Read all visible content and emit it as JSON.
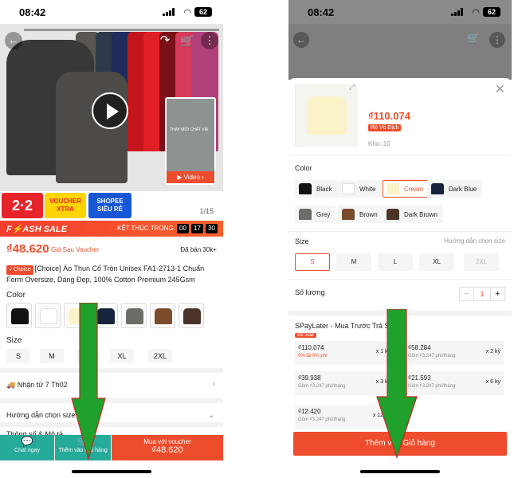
{
  "colors": {
    "accent": "#ee4d2d",
    "teal": "#26aa99",
    "arrow": "#1fa12b"
  },
  "left": {
    "status": {
      "time": "08:42",
      "battery": "62"
    },
    "hero": {
      "video_label": "▶ Video ›",
      "image_counter": "1/15",
      "thumb_caption": "THAY MỚI CHẤT VẢI"
    },
    "promo": {
      "p22": "2·2",
      "voucher": "VOUCHER",
      "xtra": "XTRA",
      "shopee": "SHOPEE",
      "sieure": "SIÊU RẺ"
    },
    "flash": {
      "title": "F⚡ASH SALE",
      "ends": "KẾT THÚC TRONG",
      "countdown": [
        "00",
        "17",
        "30"
      ]
    },
    "price": "₫48.620",
    "price_tag": "Giá Sau Voucher",
    "sold": "Đã bán 30k+",
    "choice": "✓Choice",
    "title": "[Choice] Áo Thun Cổ Tròn Unisex FA1-2713-1 Chuẩn Form Oversize, Dáng Đẹp, 100% Cotton Premium 245Gsm",
    "color_label": "Color",
    "size_label": "Size",
    "sizes": [
      "S",
      "M",
      "L",
      "XL",
      "2XL"
    ],
    "shipping": "Nhận từ 7 Th02",
    "size_guide": "Hướng dẫn chọn size",
    "spec": "Thông số & Mô tả",
    "bottom": {
      "chat": "Chat ngay",
      "cart": "Thêm vào Giỏ hàng",
      "buy": "Mua với voucher",
      "buy_price": "₫48.620"
    }
  },
  "right": {
    "status": {
      "time": "08:42",
      "battery": "62"
    },
    "price": "₫110.074",
    "badge": "Rẻ Vô Địch",
    "stock": "Kho: 10",
    "color_label": "Color",
    "colors": [
      "Black",
      "White",
      "Cream",
      "Dark Blue",
      "Grey",
      "Brown",
      "Dark Brown"
    ],
    "size_label": "Size",
    "size_guide": "Hướng dẫn chọn size",
    "sizes": [
      "S",
      "M",
      "L",
      "XL",
      "2XL"
    ],
    "qty_label": "Số lượng",
    "qty": {
      "minus": "−",
      "value": "1",
      "plus": "+"
    },
    "spaylater": "SPayLater - Mua Trước Trả Sau",
    "suggest": "Đề xuất",
    "plans": [
      {
        "amount": "₫110.074",
        "sub": "0% lãi 0% phí",
        "term": "x 1 kỳ"
      },
      {
        "amount": "₫58.284",
        "sub": "Gồm ₫3.247 phí/tháng",
        "term": "x 2 kỳ"
      },
      {
        "amount": "₫39.938",
        "sub": "Gồm ₫3.247 phí/tháng",
        "term": "x 3 kỳ"
      },
      {
        "amount": "₫21.593",
        "sub": "Gồm ₫3.247 phí/tháng",
        "term": "x 6 kỳ"
      },
      {
        "amount": "₫12.420",
        "sub": "Gồm ₫3.247 phí/tháng",
        "term": "x 12 kỳ"
      }
    ],
    "add_to_cart": "Thêm vào Giỏ hàng"
  }
}
